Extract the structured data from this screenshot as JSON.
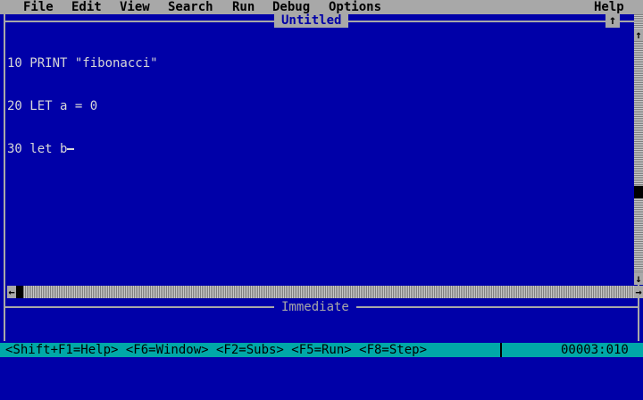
{
  "menubar": {
    "items": [
      "File",
      "Edit",
      "View",
      "Search",
      "Run",
      "Debug",
      "Options"
    ],
    "help": "Help"
  },
  "editor": {
    "title": "Untitled",
    "lines": [
      "10 PRINT \"fibonacci\"",
      "20 LET a = 0",
      "30 let b"
    ]
  },
  "immediate": {
    "title": "Immediate"
  },
  "statusbar": {
    "shortcuts": "<Shift+F1=Help> <F6=Window> <F2=Subs> <F5=Run> <F8=Step>",
    "position": "00003:010"
  },
  "icons": {
    "maximize": "↑",
    "scroll_up": "↑",
    "scroll_down": "↓",
    "scroll_left": "←",
    "scroll_right": "→"
  },
  "colors": {
    "background": "#0000a8",
    "chrome": "#a8a8a8",
    "text": "#d8d8d8",
    "statusbar": "#00a8a8"
  }
}
